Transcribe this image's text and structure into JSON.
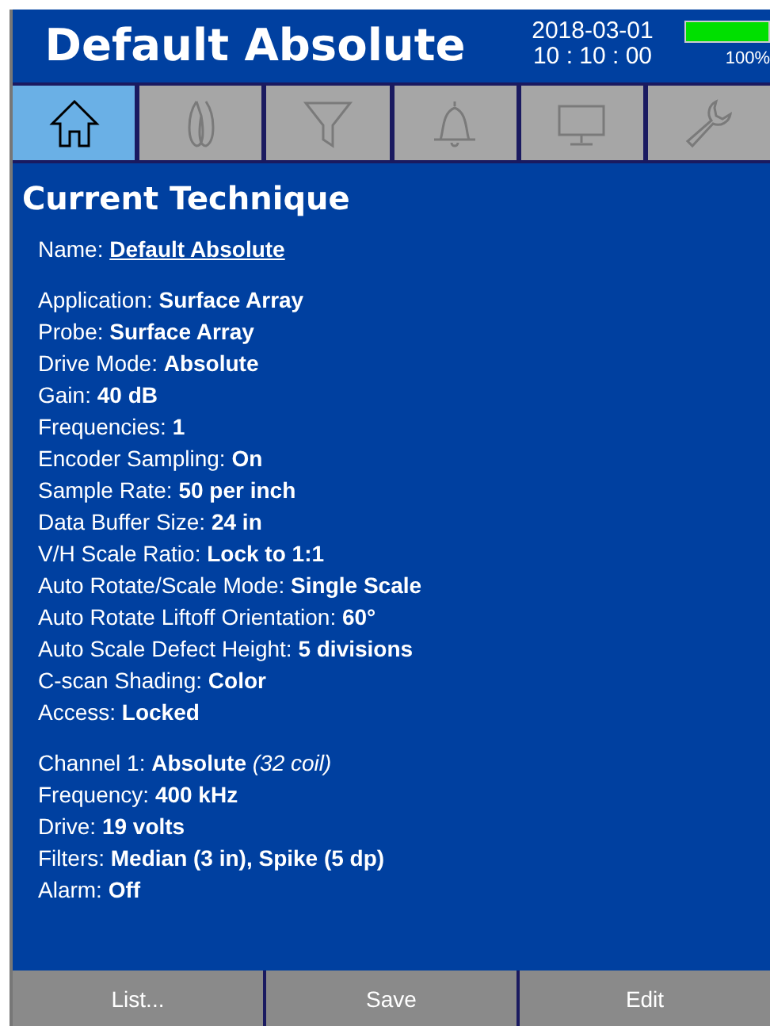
{
  "header": {
    "title": "Default Absolute",
    "date": "2018-03-01",
    "time": "10 : 10 : 00",
    "battery": {
      "level": 1.0,
      "reading": "100%"
    }
  },
  "tabs": [
    {
      "kind": "home",
      "selected": true
    },
    {
      "kind": "probe",
      "selected": false
    },
    {
      "kind": "filter",
      "selected": false
    },
    {
      "kind": "alarm",
      "selected": false
    },
    {
      "kind": "display",
      "selected": false
    },
    {
      "kind": "tools",
      "selected": false
    }
  ],
  "heading": "Current Technique",
  "sections": [
    {
      "lines": [
        {
          "label": "Name:",
          "value": "Default Absolute",
          "link": true
        }
      ]
    },
    {
      "lines": [
        {
          "label": "Application:",
          "value": "Surface Array"
        },
        {
          "label": "Probe:",
          "value": "Surface Array"
        },
        {
          "label": "Drive Mode:",
          "value": "Absolute"
        },
        {
          "label": "Gain:",
          "value": "40 dB"
        },
        {
          "label": "Frequencies:",
          "value": "1"
        },
        {
          "label": "Encoder Sampling:",
          "value": "On"
        },
        {
          "label": "Sample Rate:",
          "value": "50 per inch"
        },
        {
          "label": "Data Buffer Size:",
          "value": "24 in"
        },
        {
          "label": "V/H Scale Ratio:",
          "value": "Lock to 1:1"
        },
        {
          "label": "Auto Rotate/Scale Mode:",
          "value": "Single Scale"
        },
        {
          "label": "Auto Rotate Liftoff Orientation:",
          "value": "60°"
        },
        {
          "label": "Auto Scale Defect Height:",
          "value": "5 divisions"
        },
        {
          "label": "C-scan Shading:",
          "value": "Color"
        },
        {
          "label": "Access:",
          "value": "Locked"
        }
      ]
    },
    {
      "lines": [
        {
          "label": "Channel 1:",
          "value": "Absolute",
          "note": "(32 coil)"
        },
        {
          "label": "Frequency:",
          "value": "400 kHz"
        },
        {
          "label": "Drive:",
          "value": "19 volts"
        },
        {
          "label": "Filters:",
          "value": "Median (3 in), Spike (5 dp)"
        },
        {
          "label": "Alarm:",
          "value": "Off"
        }
      ]
    }
  ],
  "buttons": [
    "List...",
    "Save",
    "Edit"
  ]
}
